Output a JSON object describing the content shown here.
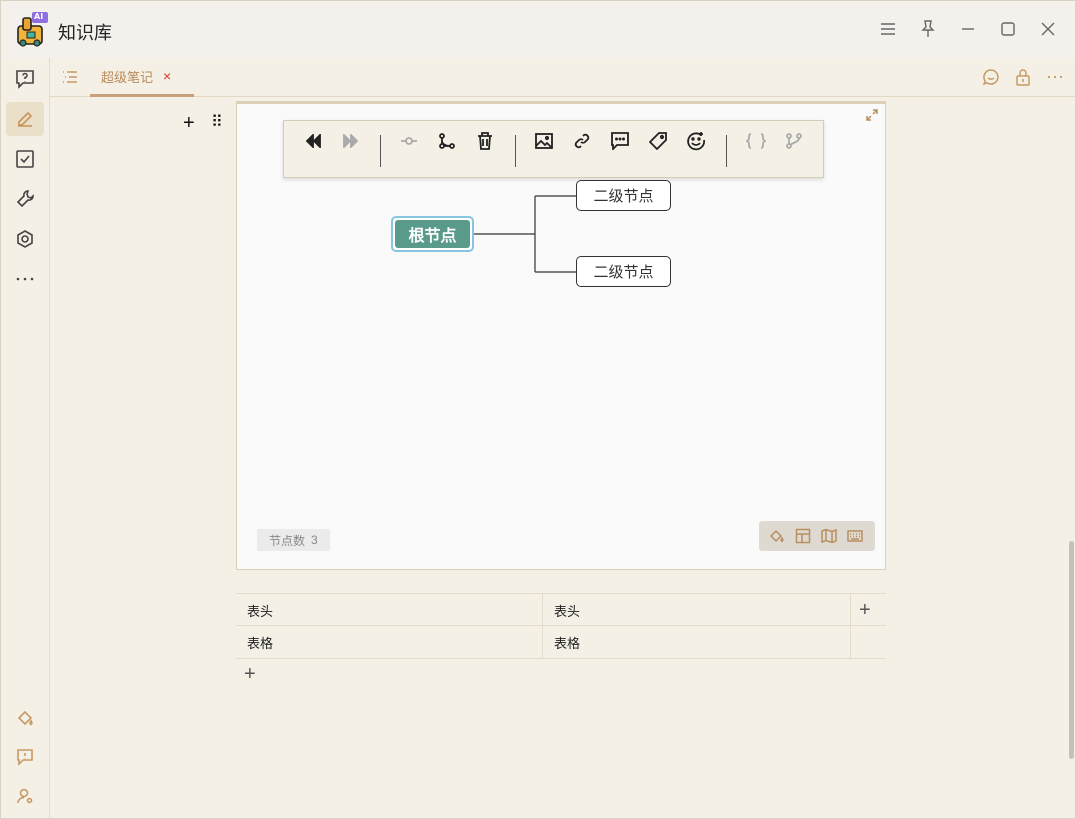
{
  "app": {
    "title": "知识库",
    "logo_badge": "AI"
  },
  "window_controls": [
    "menu-icon",
    "pin-icon",
    "minimize-icon",
    "maximize-icon",
    "close-icon"
  ],
  "sidebar": {
    "items": [
      "question-icon",
      "edit-icon",
      "checkbox-icon",
      "wrench-icon",
      "settings-icon",
      "more-icon"
    ],
    "bottom_items": [
      "paint-bucket-icon",
      "feedback-icon",
      "user-settings-icon"
    ]
  },
  "tabbar": {
    "tabs": [
      {
        "label": "超级笔记",
        "close": "×"
      }
    ],
    "right_icons": [
      "chat-icon",
      "lock-icon",
      "more-icon"
    ]
  },
  "block_controls": {
    "add": "+",
    "drag": "⠿"
  },
  "mindmap": {
    "toolbar_groups": [
      [
        "back-icon",
        "forward-icon"
      ],
      [
        "connector-icon",
        "branch-icon",
        "delete-icon"
      ],
      [
        "image-icon",
        "link-icon",
        "comment-icon",
        "tag-icon",
        "emoji-icon"
      ],
      [
        "formula-icon",
        "fork-icon"
      ]
    ],
    "root": "根节点",
    "children": [
      "二级节点",
      "二级节点"
    ],
    "node_count_label": "节点数",
    "node_count": "3",
    "footer_tools": [
      "paint-icon",
      "layout-icon",
      "map-icon",
      "keyboard-icon"
    ]
  },
  "table": {
    "headers": [
      "表头",
      "表头"
    ],
    "rows": [
      [
        "表格",
        "表格"
      ]
    ],
    "add_column": "+",
    "add_row": "+"
  },
  "colors": {
    "accent": "#c69a65",
    "root_node": "#5a9a8b",
    "close_red": "#e0352c",
    "background": "#f5f0e6"
  }
}
